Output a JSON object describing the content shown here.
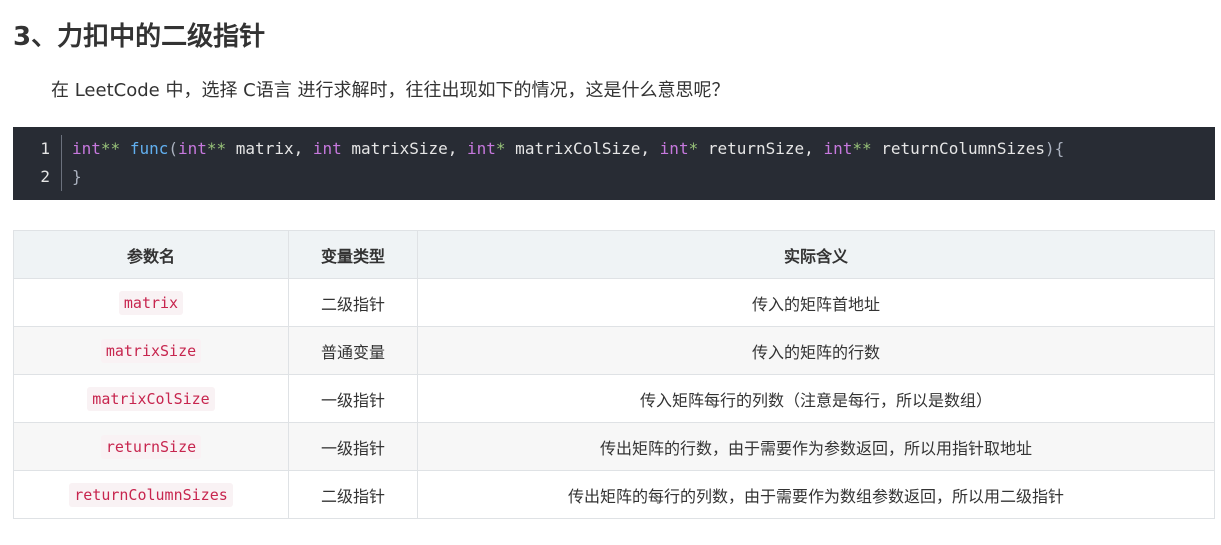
{
  "heading": "3、力扣中的二级指针",
  "intro": "在 LeetCode 中，选择 C语言 进行求解时，往往出现如下的情况，这是什么意思呢？",
  "code_block": {
    "language": "c",
    "lines": [
      {
        "number": "1",
        "tokens": [
          {
            "t": "int",
            "c": "kw"
          },
          {
            "t": "**",
            "c": "op"
          },
          {
            "t": " ",
            "c": "pl"
          },
          {
            "t": "func",
            "c": "fn"
          },
          {
            "t": "(",
            "c": "pn"
          },
          {
            "t": "int",
            "c": "kw"
          },
          {
            "t": "**",
            "c": "op"
          },
          {
            "t": " matrix, ",
            "c": "pl"
          },
          {
            "t": "int",
            "c": "kw"
          },
          {
            "t": " matrixSize, ",
            "c": "pl"
          },
          {
            "t": "int",
            "c": "kw"
          },
          {
            "t": "*",
            "c": "op"
          },
          {
            "t": " matrixColSize, ",
            "c": "pl"
          },
          {
            "t": "int",
            "c": "kw"
          },
          {
            "t": "*",
            "c": "op"
          },
          {
            "t": " returnSize, ",
            "c": "pl"
          },
          {
            "t": "int",
            "c": "kw"
          },
          {
            "t": "**",
            "c": "op"
          },
          {
            "t": " returnColumnSizes",
            "c": "pl"
          },
          {
            "t": "){",
            "c": "pn"
          }
        ]
      },
      {
        "number": "2",
        "tokens": [
          {
            "t": "}",
            "c": "pn"
          }
        ]
      }
    ],
    "colors": {
      "background": "#282c34",
      "keyword": "#c678dd",
      "operator": "#98c379",
      "function": "#61afef",
      "plain": "#e6e6e6",
      "punctuation": "#abb2bf"
    }
  },
  "table": {
    "headers": [
      "参数名",
      "变量类型",
      "实际含义"
    ],
    "rows": [
      {
        "name": "matrix",
        "type": "二级指针",
        "meaning": "传入的矩阵首地址"
      },
      {
        "name": "matrixSize",
        "type": "普通变量",
        "meaning": "传入的矩阵的行数"
      },
      {
        "name": "matrixColSize",
        "type": "一级指针",
        "meaning": "传入矩阵每行的列数（注意是每行，所以是数组）"
      },
      {
        "name": "returnSize",
        "type": "一级指针",
        "meaning": "传出矩阵的行数，由于需要作为参数返回，所以用指针取地址"
      },
      {
        "name": "returnColumnSizes",
        "type": "二级指针",
        "meaning": "传出矩阵的每行的列数，由于需要作为数组参数返回，所以用二级指针"
      }
    ]
  }
}
